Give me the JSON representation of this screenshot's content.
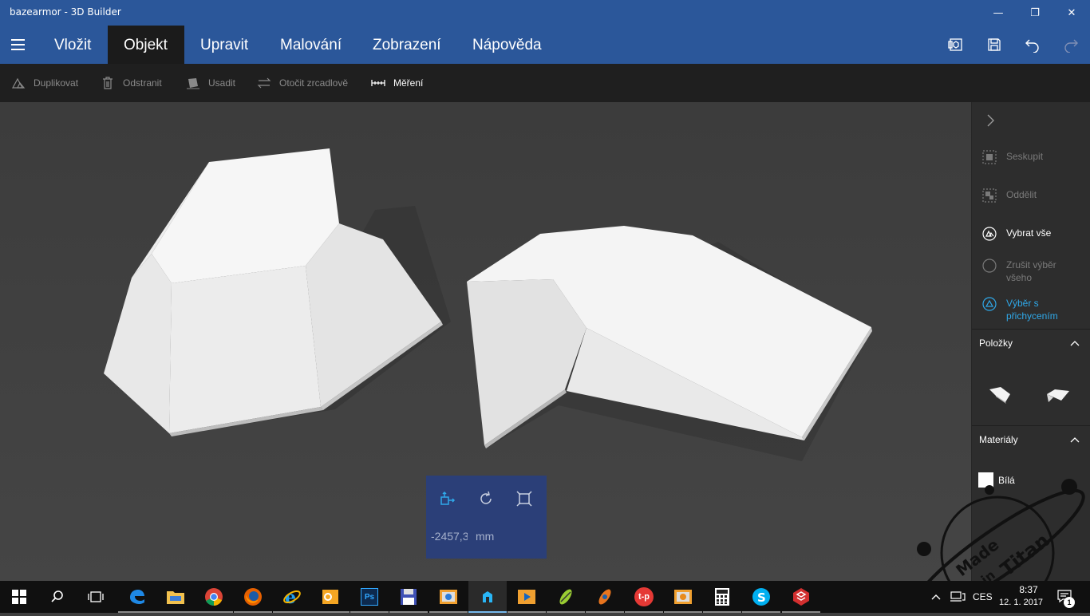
{
  "window": {
    "title": "bazearmor - 3D Builder",
    "minimize_glyph": "—",
    "maximize_glyph": "❐",
    "close_glyph": "✕"
  },
  "menu": {
    "tabs": [
      {
        "label": "Vložit"
      },
      {
        "label": "Objekt"
      },
      {
        "label": "Upravit"
      },
      {
        "label": "Malování"
      },
      {
        "label": "Zobrazení"
      },
      {
        "label": "Nápověda"
      }
    ],
    "active_tab": "Objekt",
    "right_icons": [
      "3d-view-icon",
      "save-icon",
      "undo-icon",
      "redo-icon"
    ]
  },
  "toolbar": {
    "items": [
      {
        "label": "Duplikovat",
        "icon": "duplicate-icon",
        "enabled": false
      },
      {
        "label": "Odstranit",
        "icon": "trash-icon",
        "enabled": false
      },
      {
        "label": "Usadit",
        "icon": "settle-icon",
        "enabled": false
      },
      {
        "label": "Otočit zrcadlově",
        "icon": "mirror-icon",
        "enabled": false
      },
      {
        "label": "Měření",
        "icon": "measure-icon",
        "enabled": true
      }
    ]
  },
  "side_panel": {
    "collapse_icon": "chevron-right-icon",
    "actions": [
      {
        "label": "Seskupit",
        "icon": "group-icon",
        "state": "disabled"
      },
      {
        "label": "Oddělit",
        "icon": "ungroup-icon",
        "state": "disabled"
      },
      {
        "label": "Vybrat vše",
        "icon": "select-all-icon",
        "state": "enabled"
      },
      {
        "label": "Zrušit výběr všeho",
        "icon": "deselect-icon",
        "state": "disabled"
      },
      {
        "label": "Výběr s přichycením",
        "icon": "snap-select-icon",
        "state": "accent"
      }
    ],
    "items_header": "Položky",
    "materials_header": "Materiály",
    "material": {
      "name": "Bílá",
      "color": "#ffffff"
    }
  },
  "position_popup": {
    "value": "-2457,3",
    "unit": "mm",
    "icons": [
      "move-icon",
      "rotate-icon",
      "scale-icon"
    ]
  },
  "taskbar": {
    "apps": [
      "start-icon",
      "search-icon",
      "task-view-icon",
      "edge-icon",
      "file-explorer-icon",
      "chrome-icon",
      "firefox-icon",
      "internet-explorer-icon",
      "outlook-icon",
      "photoshop-icon",
      "save-disk-icon",
      "photo-viewer-icon",
      "3d-builder-icon",
      "media-player-icon",
      "swirl-app-icon",
      "blender-icon",
      "tp-app-icon",
      "image-app-icon",
      "calculator-icon",
      "skype-icon",
      "sketchup-icon"
    ],
    "photoshop_label": "Ps",
    "tp_label": "t-p",
    "language": "CES",
    "time": "8:37",
    "date": "12. 1. 2017",
    "notifications_count": "1"
  },
  "watermark": {
    "text_line1": "Made",
    "text_line2": "in",
    "text_line3": "Titan"
  },
  "colors": {
    "accent": "#2b579a",
    "active_tab": "#1b1b1b",
    "viewport_bg": "#404040",
    "highlight": "#2fa9ea"
  }
}
